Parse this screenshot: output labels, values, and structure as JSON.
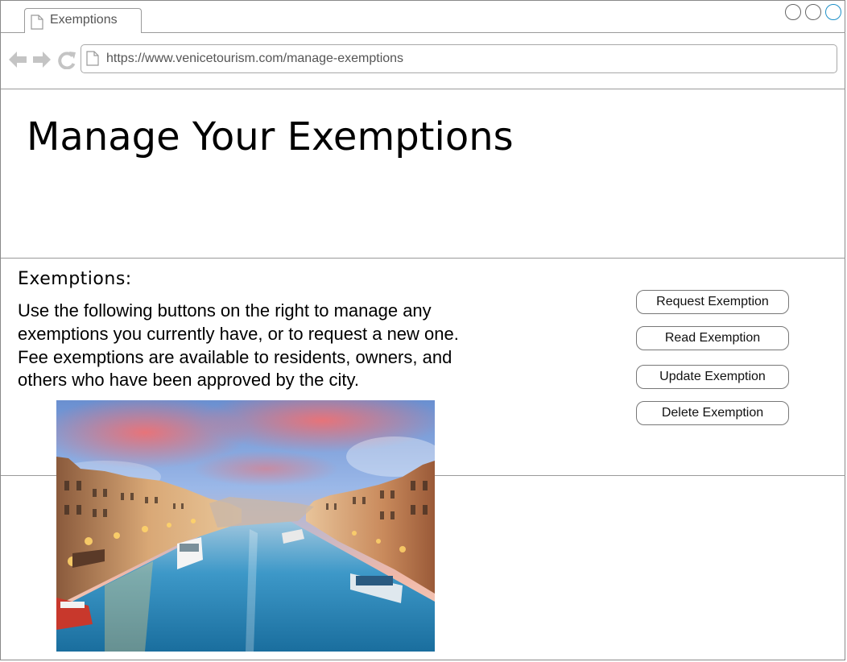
{
  "browser": {
    "tab_label": "Exemptions",
    "url": "https://www.venicetourism.com/manage-exemptions",
    "icons": [
      "back-arrow-icon",
      "forward-arrow-icon",
      "reload-icon",
      "page-icon"
    ]
  },
  "page": {
    "title": "Manage Your Exemptions"
  },
  "exemptions": {
    "heading": "Exemptions:",
    "description": "Use the following buttons on the right to manage any exemptions you currently have, or to request a new one. Fee exemptions are available to residents, owners, and others who have been approved by the city."
  },
  "actions": {
    "request": "Request Exemption",
    "read": "Read Exemption",
    "update": "Update Exemption",
    "delete": "Delete Exemption"
  },
  "colors": {
    "border": "#9a9a9a",
    "icon_gray": "#c4c4c4",
    "window_accent": "#1e90c8"
  }
}
